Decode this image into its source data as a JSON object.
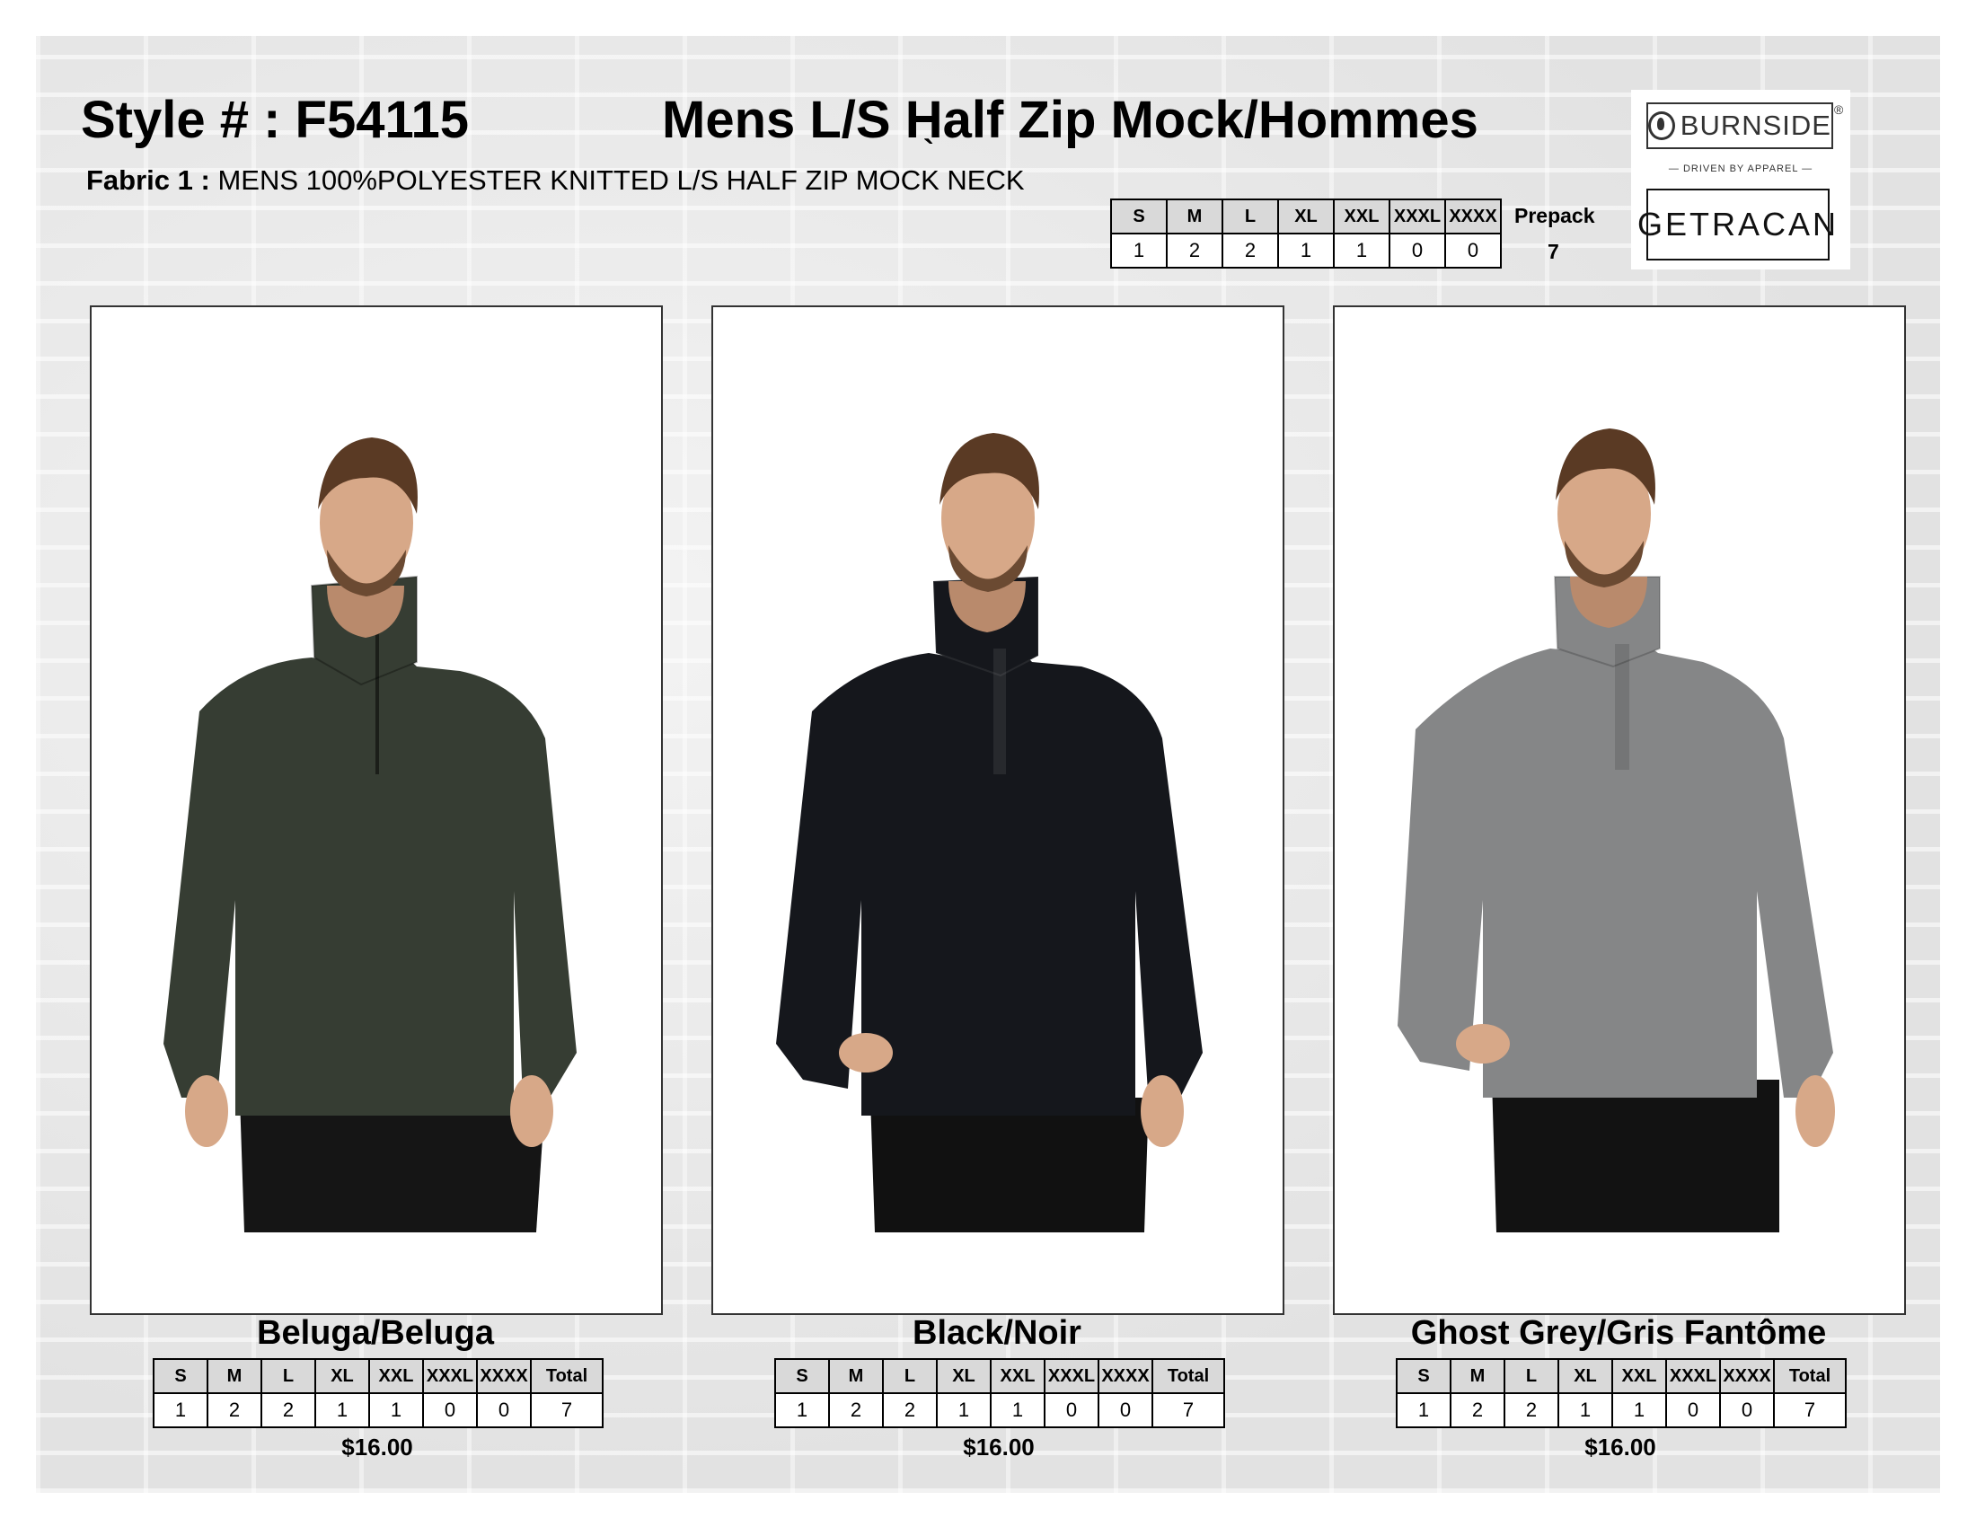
{
  "header": {
    "style_number": "Style # : F54115",
    "title": "Mens L/S Half Zip Mock/Hommes",
    "fabric_label": "Fabric 1 :",
    "fabric_desc": "MENS 100%POLYESTER KNITTED L/S HALF ZIP MOCK NECK",
    "accent_mark": "`"
  },
  "prepack": {
    "sizes": [
      "S",
      "M",
      "L",
      "XL",
      "XXL",
      "XXXL",
      "XXXX"
    ],
    "quantities": [
      "1",
      "2",
      "2",
      "1",
      "1",
      "0",
      "0"
    ],
    "label": "Prepack",
    "total": "7"
  },
  "logos": {
    "burnside": "BURNSIDE",
    "registered": "®",
    "tagline": "— DRIVEN BY APPAREL —",
    "getracan": "GETRACAN"
  },
  "products": [
    {
      "color_name": "Beluga/Beluga",
      "sweater_color": "#363d33",
      "sizes": [
        "S",
        "M",
        "L",
        "XL",
        "XXL",
        "XXXL",
        "XXXX",
        "Total"
      ],
      "quantities": [
        "1",
        "2",
        "2",
        "1",
        "1",
        "0",
        "0",
        "7"
      ],
      "price": "$16.00"
    },
    {
      "color_name": "Black/Noir",
      "sweater_color": "#15171c",
      "sizes": [
        "S",
        "M",
        "L",
        "XL",
        "XXL",
        "XXXL",
        "XXXX",
        "Total"
      ],
      "quantities": [
        "1",
        "2",
        "2",
        "1",
        "1",
        "0",
        "0",
        "7"
      ],
      "price": "$16.00"
    },
    {
      "color_name": "Ghost Grey/Gris Fantôme",
      "sweater_color": "#858687",
      "sizes": [
        "S",
        "M",
        "L",
        "XL",
        "XXL",
        "XXXL",
        "XXXX",
        "Total"
      ],
      "quantities": [
        "1",
        "2",
        "2",
        "1",
        "1",
        "0",
        "0",
        "7"
      ],
      "price": "$16.00"
    }
  ]
}
